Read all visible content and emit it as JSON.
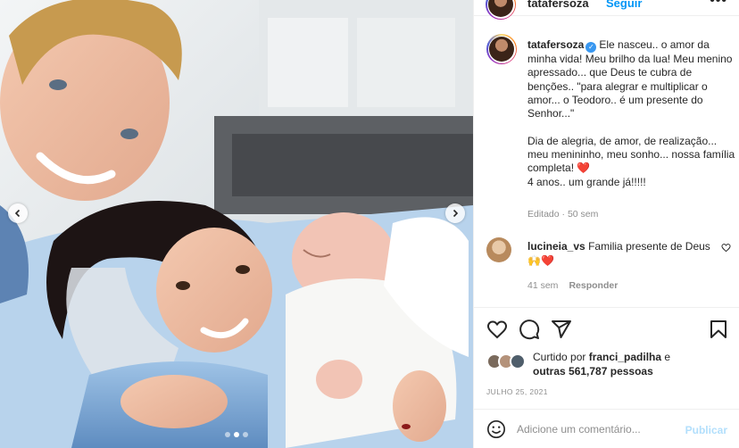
{
  "post": {
    "username": "tatafersoza",
    "follow_label": "Seguir",
    "more_label": "•••",
    "caption_text": "Ele nasceu.. o amor da minha vida! Meu brilho da lua! Meu menino apressado... que Deus te cubra de benções.. \"para alegrar e multiplicar o amor... o Teodoro.. é um presente do Senhor...\"\n\nDia de alegria, de amor, de realização... meu menininho, meu sonho... nossa família completa! ",
    "caption_heart": "❤️",
    "caption_tail": "\n4 anos.. um grande já!!!!!",
    "edited_label": "Editado · 50 sem"
  },
  "comment": {
    "username": "lucineia_vs",
    "text": "Familia presente de Deus",
    "emojis": "🙌❤️",
    "time": "41 sem",
    "reply_label": "Responder"
  },
  "likes": {
    "prefix": "Curtido por ",
    "user": "franci_padilha",
    "mid": " e",
    "line2_prefix": "outras ",
    "count": "561,787",
    "suffix": " pessoas"
  },
  "date_label": "JULHO 25, 2021",
  "add_comment": {
    "placeholder": "Adicione um comentário...",
    "publish_label": "Publicar"
  },
  "icons": {
    "like": "heart-icon",
    "comment": "comment-icon",
    "share": "share-icon",
    "save": "bookmark-icon",
    "emoji": "emoji-icon",
    "verified": "verified-badge-icon"
  },
  "colors": {
    "link": "#0095f6",
    "publish_disabled": "#b2dffc",
    "heart": "#e0245e",
    "verified": "#3897f0"
  },
  "carousel": {
    "slide_count": 3,
    "active_slide": 1
  }
}
